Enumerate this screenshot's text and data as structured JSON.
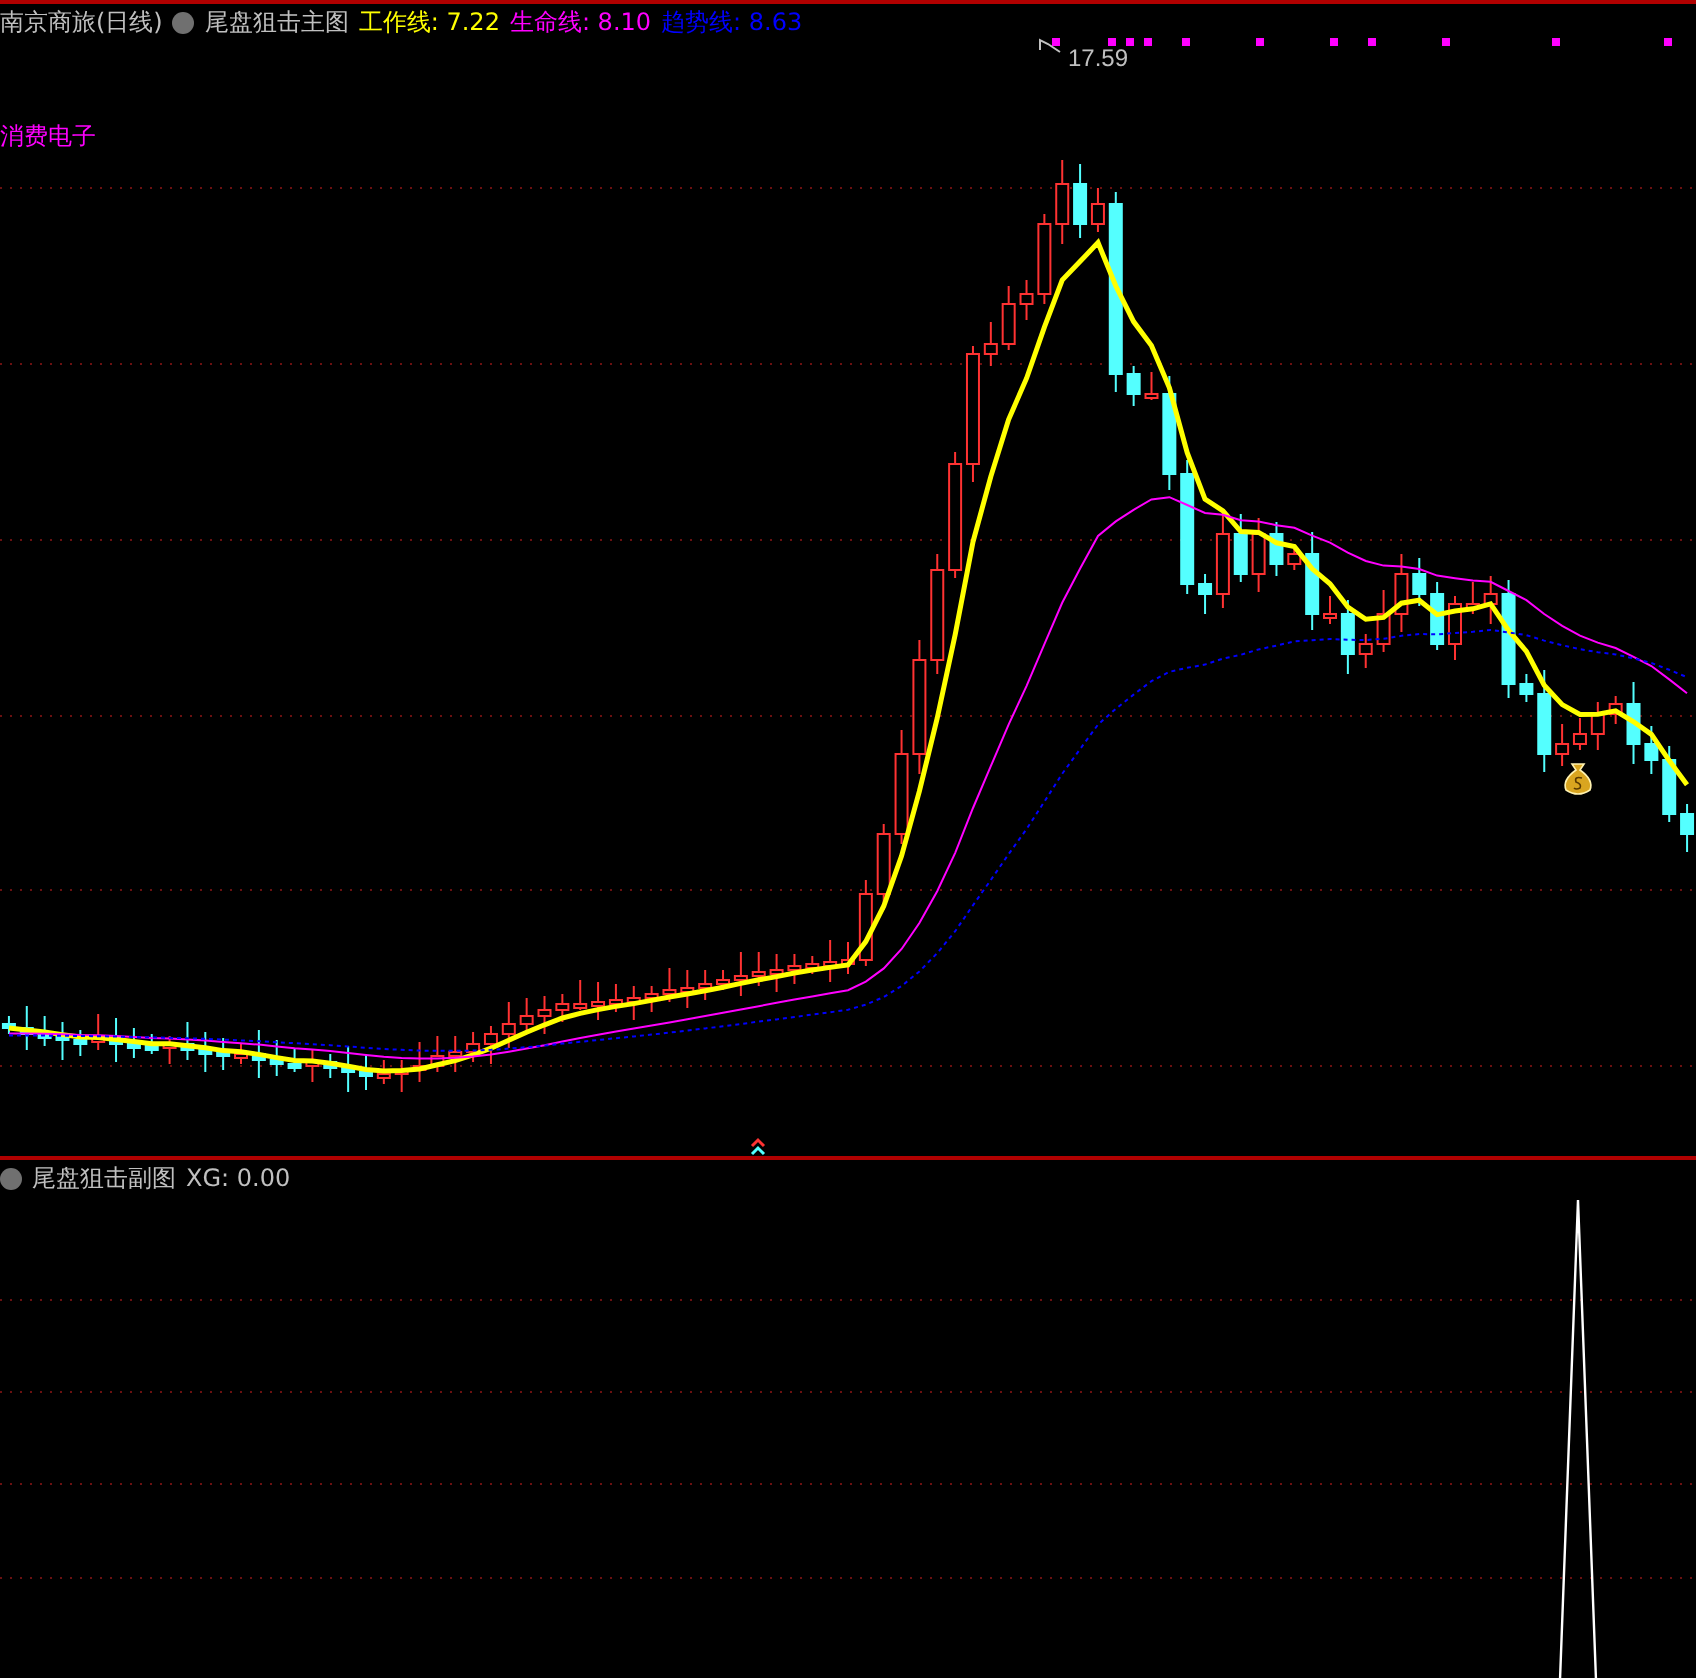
{
  "main_panel": {
    "stock": "南京商旅(日线)",
    "indicator": "尾盘狙击主图",
    "lines": [
      {
        "label": "工作线:",
        "value": "7.22",
        "color": "#ffff00"
      },
      {
        "label": "生命线:",
        "value": "8.10",
        "color": "#ff00ff"
      },
      {
        "label": "趋势线:",
        "value": "8.63",
        "color": "#0000ff"
      }
    ],
    "sector": "消费电子",
    "peak_label": "17.59"
  },
  "sub_panel": {
    "indicator": "尾盘狙击副图",
    "readout": "XG: 0.00"
  }
}
